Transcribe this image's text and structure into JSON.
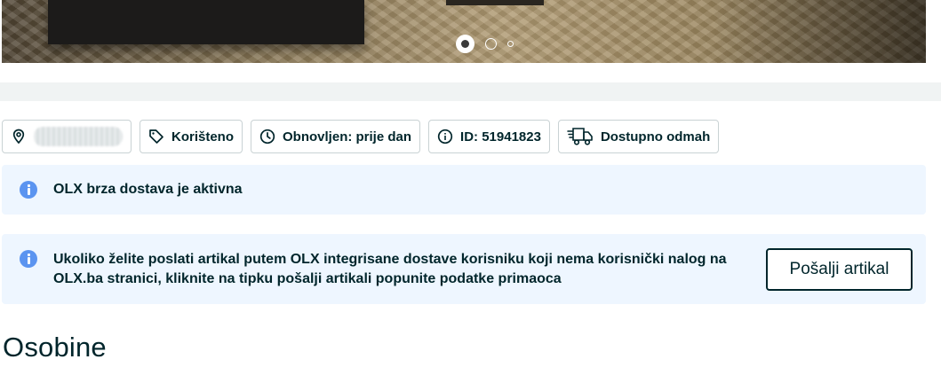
{
  "gallery": {
    "slides_total": 3,
    "active_slide": 1
  },
  "tags": {
    "location_icon": "map-pin-icon",
    "condition": {
      "icon": "tag-icon",
      "label": "Korišteno"
    },
    "refreshed": {
      "icon": "clock-icon",
      "label": "Obnovljen: prije dan"
    },
    "listing_id": {
      "icon": "info-circle-icon",
      "label": "ID: 51941823"
    },
    "availability": {
      "icon": "delivery-truck-icon",
      "label": "Dostupno odmah"
    }
  },
  "notices": {
    "fast_delivery": {
      "icon": "info-icon",
      "text": "OLX brza dostava je aktivna"
    },
    "send_item": {
      "icon": "info-icon",
      "text": "Ukoliko želite poslati artikal putem OLX integrisane dostave korisniku koji nema korisnički nalog na OLX.ba stranici, kliknite na tipku pošalji artikali popunite podatke primaoca",
      "button_label": "Pošalji artikal"
    }
  },
  "section": {
    "title": "Osobine"
  },
  "colors": {
    "text": "#00252b",
    "notice_bg": "#eef6ff",
    "info_icon": "#5b94f0",
    "tag_border": "#c9d2d4",
    "band": "#f0f3f3"
  }
}
